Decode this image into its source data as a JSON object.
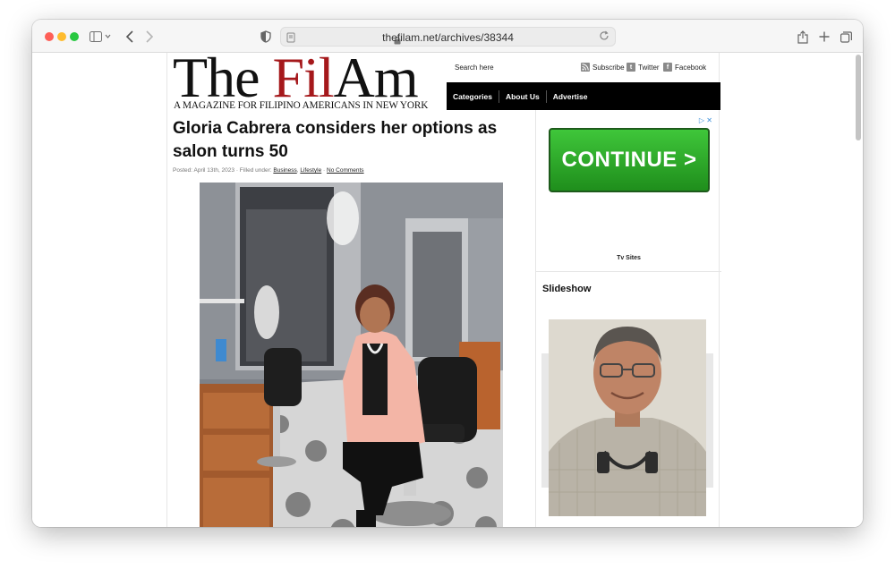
{
  "browser": {
    "url": "thefilam.net/archives/38344",
    "icons": [
      "sidebar-icon",
      "back-icon",
      "forward-icon",
      "shield-icon",
      "lock-icon",
      "reload-icon",
      "share-icon",
      "new-tab-icon",
      "tabs-overview-icon"
    ]
  },
  "header": {
    "logo_part1": "The ",
    "logo_part2": "Fil",
    "logo_part3": "Am",
    "tagline": "A MAGAZINE FOR FILIPINO AMERICANS IN NEW YORK",
    "search_label": "Search here",
    "social": [
      {
        "label": "Subscribe",
        "icon": "rss-icon"
      },
      {
        "label": "Twitter",
        "icon": "twitter-icon"
      },
      {
        "label": "Facebook",
        "icon": "facebook-icon"
      }
    ],
    "nav": [
      "Categories",
      "About Us",
      "Advertise"
    ]
  },
  "post": {
    "title": "Gloria Cabrera considers her options as salon turns 50",
    "meta_posted": "Posted: April 13th, 2023 · Filled under: ",
    "category1": "Business",
    "category_sep": ", ",
    "category2": "Lifestyle",
    "meta_dot": " · ",
    "comments": "No Comments"
  },
  "sidebar": {
    "ad_button": "CONTINUE >",
    "ad_caption": "Tv Sites",
    "slideshow_title": "Slideshow"
  },
  "colors": {
    "logo_red": "#a5181b",
    "nav_bg": "#000000",
    "ad_green": "#2fa82b"
  }
}
